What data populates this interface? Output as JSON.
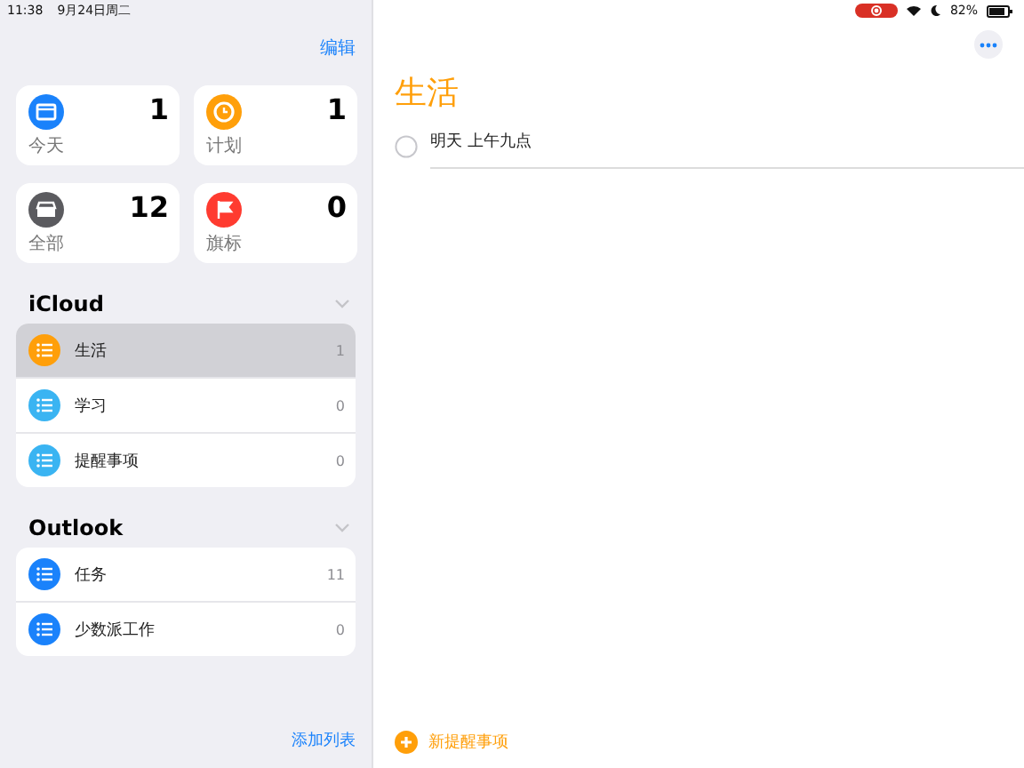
{
  "status_bar": {
    "time": "11:38",
    "date": "9月24日周二",
    "battery": "82%"
  },
  "sidebar": {
    "edit_button": "编辑",
    "smart_lists": [
      {
        "kind": "today",
        "title": "今天",
        "count": "1",
        "color": "#1a82fb"
      },
      {
        "kind": "scheduled",
        "title": "计划",
        "count": "1",
        "color": "#ff9f0a"
      },
      {
        "kind": "all",
        "title": "全部",
        "count": "12",
        "color": "#5b5b5f"
      },
      {
        "kind": "flagged",
        "title": "旗标",
        "count": "0",
        "color": "#ff3b30"
      }
    ],
    "groups": [
      {
        "title": "iCloud",
        "lists": [
          {
            "name": "生活",
            "count": "1",
            "color": "#ff9f0a",
            "selected": true
          },
          {
            "name": "学习",
            "count": "0",
            "color": "#3ab4f2",
            "selected": false
          },
          {
            "name": "提醒事项",
            "count": "0",
            "color": "#3ab4f2",
            "selected": false
          }
        ]
      },
      {
        "title": "Outlook",
        "lists": [
          {
            "name": "任务",
            "count": "11",
            "color": "#1a82fb",
            "selected": false
          },
          {
            "name": "少数派工作",
            "count": "0",
            "color": "#1a82fb",
            "selected": false
          }
        ]
      }
    ],
    "add_list": "添加列表"
  },
  "detail": {
    "title": "生活",
    "reminders": [
      {
        "title": "明天 上午九点",
        "completed": false
      }
    ],
    "new_reminder": "新提醒事项"
  }
}
